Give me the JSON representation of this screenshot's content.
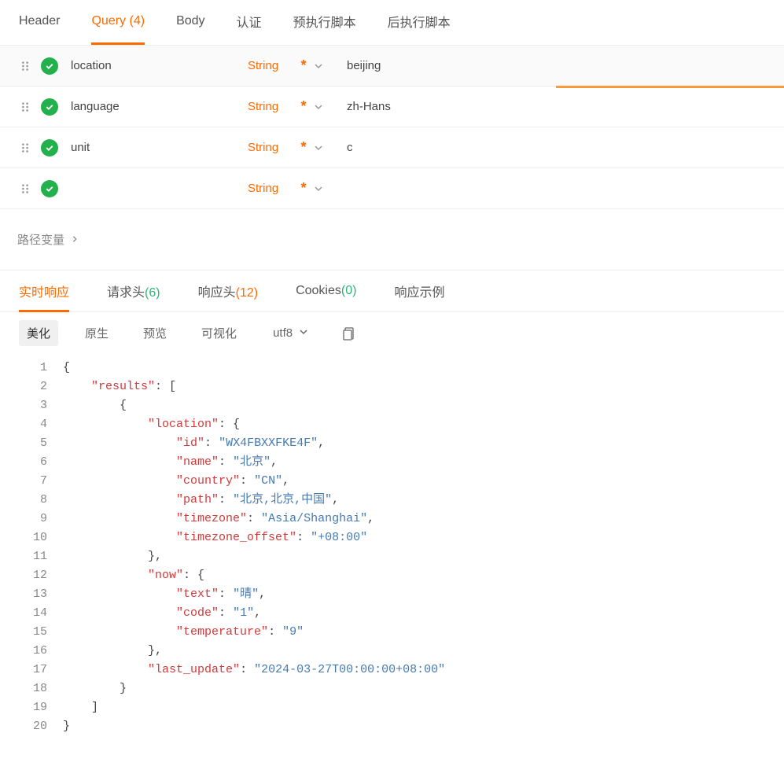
{
  "topTabs": [
    {
      "label": "Header",
      "count": ""
    },
    {
      "label": "Query",
      "count": "(4)"
    },
    {
      "label": "Body",
      "count": ""
    },
    {
      "label": "认证",
      "count": ""
    },
    {
      "label": "预执行脚本",
      "count": ""
    },
    {
      "label": "后执行脚本",
      "count": ""
    }
  ],
  "params": [
    {
      "name": "location",
      "type": "String",
      "req": "*",
      "value": "beijing"
    },
    {
      "name": "language",
      "type": "String",
      "req": "*",
      "value": "zh-Hans"
    },
    {
      "name": "unit",
      "type": "String",
      "req": "*",
      "value": "c"
    },
    {
      "name": "",
      "type": "String",
      "req": "*",
      "value": ""
    }
  ],
  "pathVars": {
    "label": "路径变量"
  },
  "respTabs": [
    {
      "label": "实时响应",
      "count": "",
      "cls": ""
    },
    {
      "label": "请求头",
      "count": "(6)",
      "cls": "green"
    },
    {
      "label": "响应头",
      "count": "(12)",
      "cls": "orange"
    },
    {
      "label": "Cookies",
      "count": "(0)",
      "cls": "green"
    },
    {
      "label": "响应示例",
      "count": "",
      "cls": ""
    }
  ],
  "formatBar": {
    "items": [
      "美化",
      "原生",
      "预览",
      "可视化"
    ],
    "encoding": "utf8"
  },
  "code": {
    "lines": [
      {
        "n": "1",
        "ind": 0,
        "tokens": [
          [
            "punc",
            "{"
          ]
        ]
      },
      {
        "n": "2",
        "ind": 1,
        "tokens": [
          [
            "key",
            "\"results\""
          ],
          [
            "punc",
            ": ["
          ]
        ]
      },
      {
        "n": "3",
        "ind": 2,
        "tokens": [
          [
            "punc",
            "{"
          ]
        ]
      },
      {
        "n": "4",
        "ind": 3,
        "tokens": [
          [
            "key",
            "\"location\""
          ],
          [
            "punc",
            ": {"
          ]
        ]
      },
      {
        "n": "5",
        "ind": 4,
        "tokens": [
          [
            "key",
            "\"id\""
          ],
          [
            "punc",
            ": "
          ],
          [
            "str",
            "\"WX4FBXXFKE4F\""
          ],
          [
            "punc",
            ","
          ]
        ]
      },
      {
        "n": "6",
        "ind": 4,
        "tokens": [
          [
            "key",
            "\"name\""
          ],
          [
            "punc",
            ": "
          ],
          [
            "str",
            "\"北京\""
          ],
          [
            "punc",
            ","
          ]
        ]
      },
      {
        "n": "7",
        "ind": 4,
        "tokens": [
          [
            "key",
            "\"country\""
          ],
          [
            "punc",
            ": "
          ],
          [
            "str",
            "\"CN\""
          ],
          [
            "punc",
            ","
          ]
        ]
      },
      {
        "n": "8",
        "ind": 4,
        "tokens": [
          [
            "key",
            "\"path\""
          ],
          [
            "punc",
            ": "
          ],
          [
            "str",
            "\"北京,北京,中国\""
          ],
          [
            "punc",
            ","
          ]
        ]
      },
      {
        "n": "9",
        "ind": 4,
        "tokens": [
          [
            "key",
            "\"timezone\""
          ],
          [
            "punc",
            ": "
          ],
          [
            "str",
            "\"Asia/Shanghai\""
          ],
          [
            "punc",
            ","
          ]
        ]
      },
      {
        "n": "10",
        "ind": 4,
        "tokens": [
          [
            "key",
            "\"timezone_offset\""
          ],
          [
            "punc",
            ": "
          ],
          [
            "str",
            "\"+08:00\""
          ]
        ]
      },
      {
        "n": "11",
        "ind": 3,
        "tokens": [
          [
            "punc",
            "},"
          ]
        ]
      },
      {
        "n": "12",
        "ind": 3,
        "tokens": [
          [
            "key",
            "\"now\""
          ],
          [
            "punc",
            ": {"
          ]
        ]
      },
      {
        "n": "13",
        "ind": 4,
        "tokens": [
          [
            "key",
            "\"text\""
          ],
          [
            "punc",
            ": "
          ],
          [
            "str",
            "\"晴\""
          ],
          [
            "punc",
            ","
          ]
        ]
      },
      {
        "n": "14",
        "ind": 4,
        "tokens": [
          [
            "key",
            "\"code\""
          ],
          [
            "punc",
            ": "
          ],
          [
            "str",
            "\"1\""
          ],
          [
            "punc",
            ","
          ]
        ]
      },
      {
        "n": "15",
        "ind": 4,
        "tokens": [
          [
            "key",
            "\"temperature\""
          ],
          [
            "punc",
            ": "
          ],
          [
            "str",
            "\"9\""
          ]
        ]
      },
      {
        "n": "16",
        "ind": 3,
        "tokens": [
          [
            "punc",
            "},"
          ]
        ]
      },
      {
        "n": "17",
        "ind": 3,
        "tokens": [
          [
            "key",
            "\"last_update\""
          ],
          [
            "punc",
            ": "
          ],
          [
            "str",
            "\"2024-03-27T00:00:00+08:00\""
          ]
        ]
      },
      {
        "n": "18",
        "ind": 2,
        "tokens": [
          [
            "punc",
            "}"
          ]
        ]
      },
      {
        "n": "19",
        "ind": 1,
        "tokens": [
          [
            "punc",
            "]"
          ]
        ]
      },
      {
        "n": "20",
        "ind": 0,
        "tokens": [
          [
            "punc",
            "}"
          ]
        ]
      }
    ]
  }
}
